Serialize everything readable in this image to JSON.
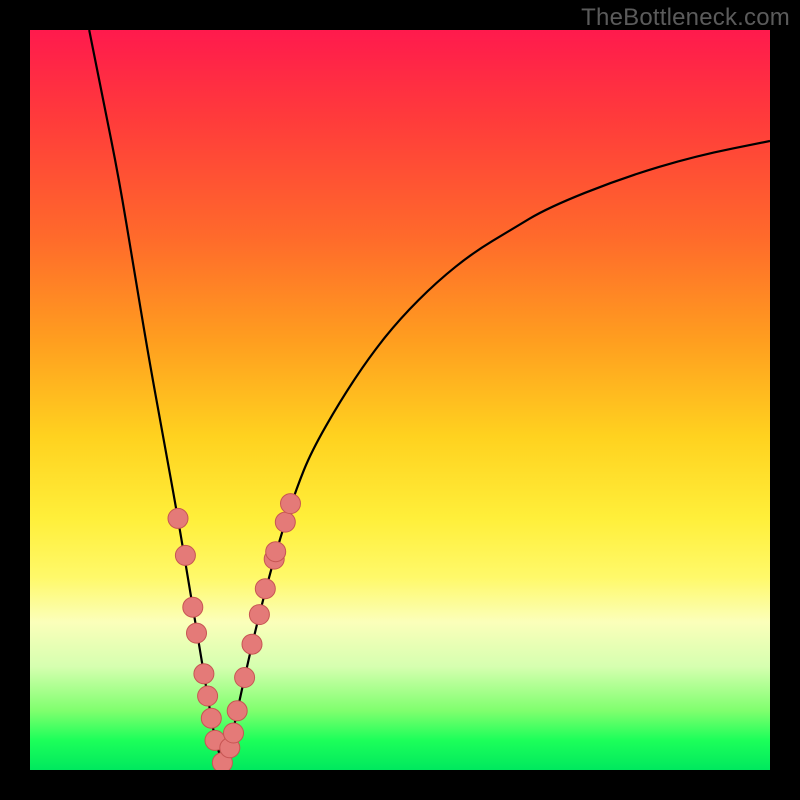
{
  "watermark": "TheBottleneck.com",
  "colors": {
    "frame": "#000000",
    "curve_stroke": "#000000",
    "marker_fill": "#e47a78",
    "marker_stroke": "#c75553"
  },
  "chart_data": {
    "type": "line",
    "title": "",
    "xlabel": "",
    "ylabel": "",
    "xlim": [
      0,
      100
    ],
    "ylim": [
      0,
      100
    ],
    "note": "V-shaped bottleneck curve on rainbow gradient. Values estimated from pixel gridlines; vertex (0 bottleneck) near x≈26.",
    "series": [
      {
        "name": "bottleneck-curve",
        "x": [
          8,
          10,
          12,
          14,
          16,
          18,
          20,
          22,
          24,
          25,
          26,
          27,
          28,
          30,
          32,
          34,
          36,
          38,
          42,
          46,
          50,
          55,
          60,
          65,
          70,
          80,
          90,
          100
        ],
        "y": [
          100,
          90,
          80,
          68,
          56,
          45,
          34,
          22,
          10,
          4,
          1,
          3,
          8,
          17,
          25,
          32,
          38,
          43,
          50,
          56,
          61,
          66,
          70,
          73,
          76,
          80,
          83,
          85
        ]
      }
    ],
    "markers": {
      "name": "highlighted-points",
      "x": [
        20,
        21,
        22,
        22.5,
        23.5,
        24,
        24.5,
        25,
        26,
        27,
        27.5,
        28,
        29,
        30,
        31,
        31.8,
        33,
        33.2,
        34.5,
        35.2
      ],
      "y": [
        34,
        29,
        22,
        18.5,
        13,
        10,
        7,
        4,
        1,
        3,
        5,
        8,
        12.5,
        17,
        21,
        24.5,
        28.5,
        29.5,
        33.5,
        36
      ]
    },
    "background_gradient": [
      {
        "stop": 0.0,
        "color": "#ff1a4d"
      },
      {
        "stop": 0.12,
        "color": "#ff3b3b"
      },
      {
        "stop": 0.28,
        "color": "#ff6a2b"
      },
      {
        "stop": 0.42,
        "color": "#ff9e1f"
      },
      {
        "stop": 0.55,
        "color": "#ffd21f"
      },
      {
        "stop": 0.66,
        "color": "#ffef3a"
      },
      {
        "stop": 0.74,
        "color": "#fff96a"
      },
      {
        "stop": 0.8,
        "color": "#fbffba"
      },
      {
        "stop": 0.86,
        "color": "#d6ffb0"
      },
      {
        "stop": 0.92,
        "color": "#7fff6e"
      },
      {
        "stop": 0.96,
        "color": "#1cff5a"
      },
      {
        "stop": 1.0,
        "color": "#00e85e"
      }
    ]
  }
}
